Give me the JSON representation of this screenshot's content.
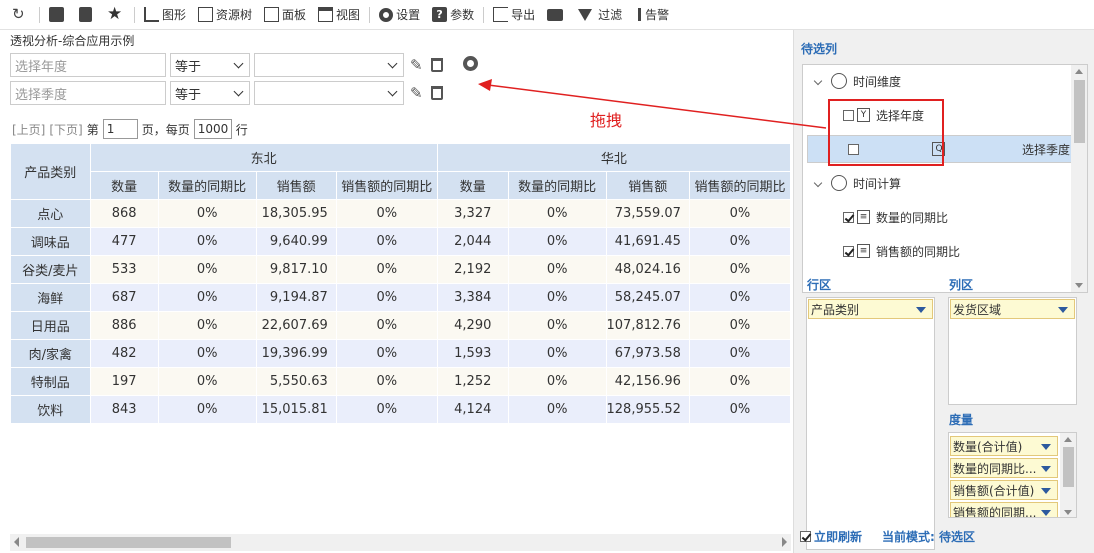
{
  "toolbar": {
    "items": [
      {
        "label": "",
        "icon": "refresh-icon"
      },
      {
        "label": "",
        "icon": "save-icon"
      },
      {
        "label": "",
        "icon": "save-as-icon"
      },
      {
        "label": "",
        "icon": "favorite-icon"
      },
      {
        "label": "图形",
        "icon": "chart-icon"
      },
      {
        "label": "资源树",
        "icon": "resource-tree-icon"
      },
      {
        "label": "面板",
        "icon": "panel-icon"
      },
      {
        "label": "视图",
        "icon": "view-icon"
      },
      {
        "label": "设置",
        "icon": "settings-icon"
      },
      {
        "label": "参数",
        "icon": "parameter-icon"
      },
      {
        "label": "导出",
        "icon": "export-icon"
      },
      {
        "label": "",
        "icon": "print-icon"
      },
      {
        "label": "过滤",
        "icon": "filter-icon"
      },
      {
        "label": "告警",
        "icon": "alert-icon"
      }
    ]
  },
  "report_title": "透视分析-综合应用示例",
  "filters": [
    {
      "placeholder": "选择年度",
      "operator": "等于",
      "value": ""
    },
    {
      "placeholder": "选择季度",
      "operator": "等于",
      "value": ""
    }
  ],
  "pager": {
    "prev": "[上页]",
    "next": "[下页]",
    "page_prefix": "第",
    "page": "1",
    "page_suffix": "页，每页",
    "per_page": "1000",
    "rows_suffix": "行"
  },
  "drag_label": "拖拽",
  "table": {
    "row_header": "产品类别",
    "groups": [
      "东北",
      "华北"
    ],
    "measures": [
      "数量",
      "数量的同期比",
      "销售额",
      "销售额的同期比",
      "数量",
      "数量的同期比",
      "销售额",
      "销售额的同期比"
    ],
    "rows": [
      {
        "name": "点心",
        "cells": [
          "868",
          "0%",
          "18,305.95",
          "0%",
          "3,327",
          "0%",
          "73,559.07",
          "0%"
        ]
      },
      {
        "name": "调味品",
        "cells": [
          "477",
          "0%",
          "9,640.99",
          "0%",
          "2,044",
          "0%",
          "41,691.45",
          "0%"
        ]
      },
      {
        "name": "谷类/麦片",
        "cells": [
          "533",
          "0%",
          "9,817.10",
          "0%",
          "2,192",
          "0%",
          "48,024.16",
          "0%"
        ]
      },
      {
        "name": "海鲜",
        "cells": [
          "687",
          "0%",
          "9,194.87",
          "0%",
          "3,384",
          "0%",
          "58,245.07",
          "0%"
        ]
      },
      {
        "name": "日用品",
        "cells": [
          "886",
          "0%",
          "22,607.69",
          "0%",
          "4,290",
          "0%",
          "107,812.76",
          "0%"
        ]
      },
      {
        "name": "肉/家禽",
        "cells": [
          "482",
          "0%",
          "19,396.99",
          "0%",
          "1,593",
          "0%",
          "67,973.58",
          "0%"
        ]
      },
      {
        "name": "特制品",
        "cells": [
          "197",
          "0%",
          "5,550.63",
          "0%",
          "1,252",
          "0%",
          "42,156.96",
          "0%"
        ]
      },
      {
        "name": "饮料",
        "cells": [
          "843",
          "0%",
          "15,015.81",
          "0%",
          "4,124",
          "0%",
          "128,955.52",
          "0%"
        ]
      }
    ]
  },
  "panel": {
    "candidates_title": "待选列",
    "tree": [
      {
        "label": "时间维度",
        "type": "folder"
      },
      {
        "label": "选择年度",
        "type": "field",
        "checked": false,
        "glyph": "Y"
      },
      {
        "label": "选择季度",
        "type": "field",
        "checked": false,
        "glyph": "Q"
      },
      {
        "label": "时间计算",
        "type": "folder"
      },
      {
        "label": "数量的同期比",
        "type": "field",
        "checked": true,
        "glyph": "≡"
      },
      {
        "label": "销售额的同期比",
        "type": "field",
        "checked": true,
        "glyph": "≡"
      }
    ],
    "row_zone_title": "行区",
    "row_fields": [
      "产品类别"
    ],
    "col_zone_title": "列区",
    "col_fields": [
      "发货区域"
    ],
    "measure_zone_title": "度量",
    "measure_fields": [
      "数量(合计值)",
      "数量的同期比...",
      "销售额(合计值)",
      "销售额的同期..."
    ],
    "auto_refresh_label": "立即刷新",
    "mode_label": "当前模式: 待选区"
  },
  "colors": {
    "accent": "#2d6db6",
    "header_bg": "#d4e1f1",
    "highlight": "#e02020"
  }
}
